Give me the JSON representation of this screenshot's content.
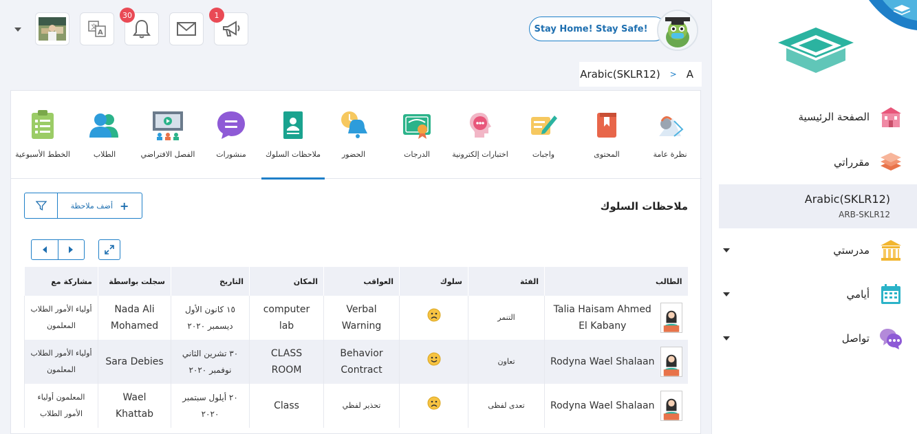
{
  "header": {
    "notifications_badge": "30",
    "announcements_badge": "1",
    "banner_button": "Stay Home! Stay Safe!",
    "breadcrumb": [
      "A",
      ">",
      "Arabic(SKLR12)"
    ]
  },
  "sidebar": {
    "items": [
      {
        "label": "الصفحة الرئيسية",
        "icon": "home-icon"
      },
      {
        "label": "مقرراتي",
        "icon": "stack-icon"
      },
      {
        "label": "مدرستي",
        "icon": "school-icon"
      },
      {
        "label": "أيامي",
        "icon": "calendar-icon"
      },
      {
        "label": "تواصل",
        "icon": "chat-icon"
      }
    ],
    "active_course": {
      "title": "Arabic(SKLR12)",
      "code": "ARB-SKLR12"
    }
  },
  "tabs": [
    {
      "label": "نظرة عامة",
      "icon": "overview-icon"
    },
    {
      "label": "المحتوى",
      "icon": "book-icon"
    },
    {
      "label": "واجبات",
      "icon": "assignment-icon"
    },
    {
      "label": "اختبارات إلكترونية",
      "icon": "quiz-icon"
    },
    {
      "label": "الدرجات",
      "icon": "grades-icon"
    },
    {
      "label": "الحضور",
      "icon": "attendance-icon"
    },
    {
      "label": "ملاحظات السلوك",
      "icon": "behavior-icon"
    },
    {
      "label": "منشورات",
      "icon": "posts-icon"
    },
    {
      "label": "الفصل الافتراضي",
      "icon": "virtual-class-icon"
    },
    {
      "label": "الطلاب",
      "icon": "students-icon"
    },
    {
      "label": "الخطط الأسبوعية",
      "icon": "weekly-plan-icon"
    }
  ],
  "section": {
    "title": "ملاحظات السلوك",
    "add_label": "أضف ملاحظة"
  },
  "table": {
    "headers": [
      "الطالب",
      "الفئة",
      "سلوك",
      "العواقب",
      "المكان",
      "التاريخ",
      "سجلت بواسطة",
      "مشاركة مع"
    ],
    "rows": [
      {
        "student": "Talia Haisam Ahmed El Kabany",
        "category": "التنمر",
        "behavior": "sad",
        "consequence": "Verbal Warning",
        "place": "computer lab",
        "date": "١٥ كانون الأول ديسمبر ٢٠٢٠",
        "recorded_by": "Nada Ali Mohamed",
        "shared_with": "أولياء الأمور الطلاب المعلمون"
      },
      {
        "student": "Rodyna Wael Shalaan",
        "category": "تعاون",
        "behavior": "happy",
        "consequence": "Behavior Contract",
        "place": "CLASS ROOM",
        "date": "٣٠ تشرين الثاني نوفمبر ٢٠٢٠",
        "recorded_by": "Sara Debies",
        "shared_with": "أولياء الأمور الطلاب المعلمون"
      },
      {
        "student": "Rodyna Wael Shalaan",
        "category": "تعدى لفظى",
        "behavior": "sad",
        "consequence": "تحذير لفظي",
        "place": "Class",
        "date": "٢٠ أيلول سبتمبر ٢٠٢٠",
        "recorded_by": "Wael Khattab",
        "shared_with": "المعلمون أولياء الأمور الطلاب"
      }
    ]
  },
  "colors": {
    "accent": "#1e7fc8",
    "badge": "#e94a55",
    "sidebar_active": "#eceef5"
  }
}
